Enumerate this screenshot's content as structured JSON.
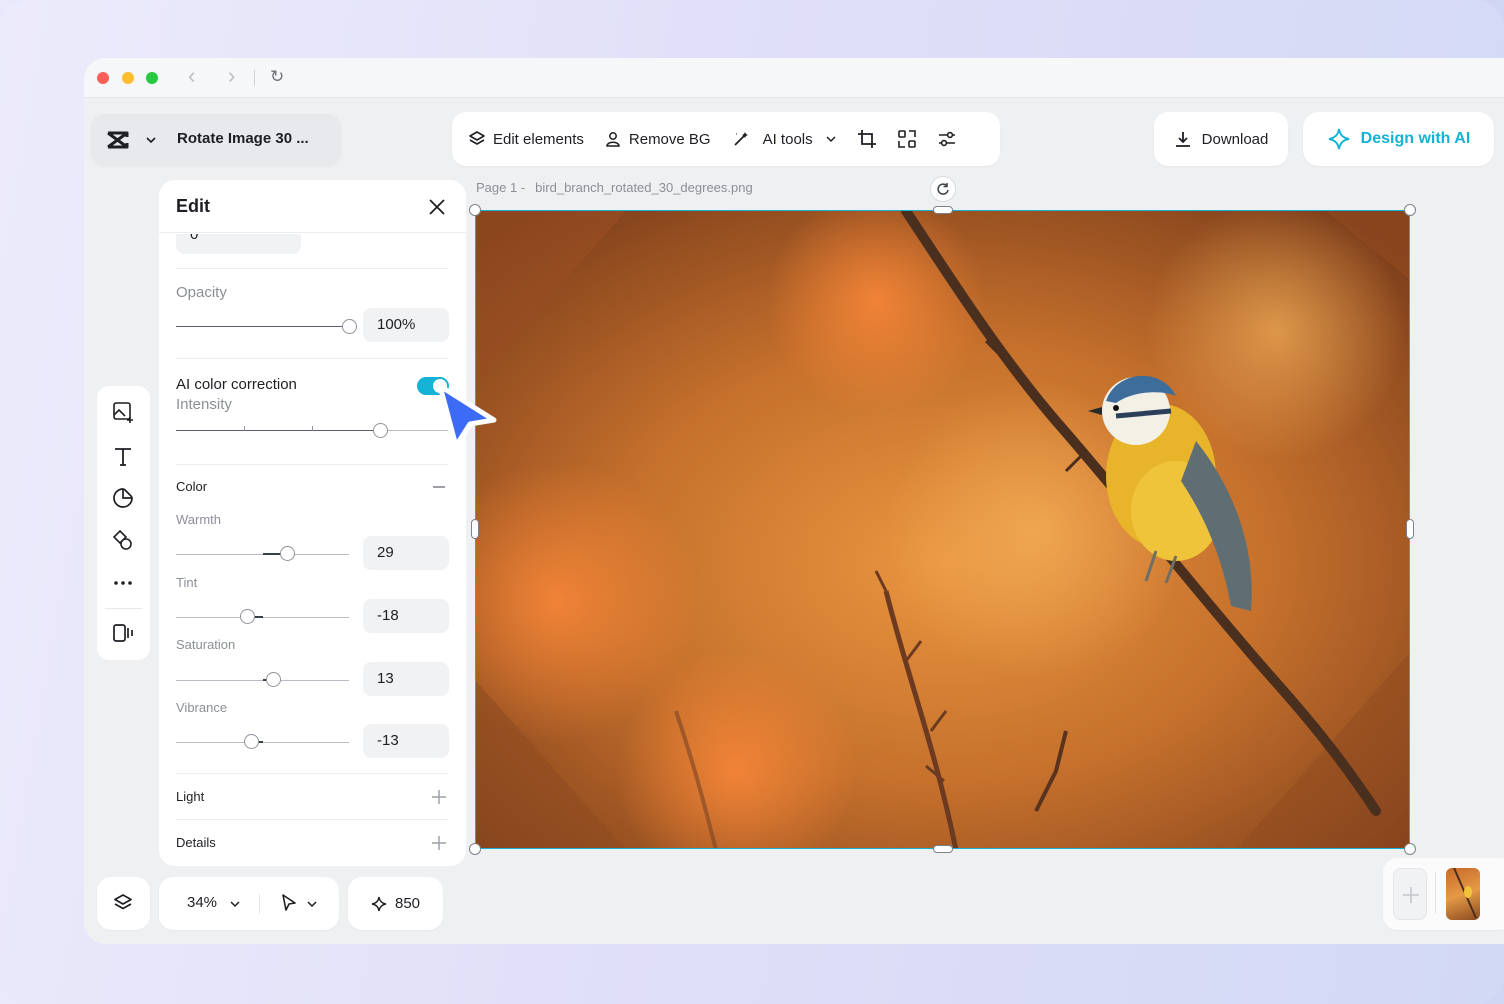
{
  "window": {
    "back_glyph": "‹",
    "forward_glyph": "›",
    "reload_glyph": "↻"
  },
  "project": {
    "title": "Rotate Image 30 ...",
    "logo_icon": "capcut-logo-icon"
  },
  "toolbar": {
    "edit_elements": "Edit elements",
    "remove_bg": "Remove BG",
    "ai_tools": "AI tools"
  },
  "actions": {
    "download": "Download",
    "design_ai": "Design with AI",
    "accent": "#14b3d6"
  },
  "canvas": {
    "page_label": "Page 1 -",
    "file_name": "bird_branch_rotated_30_degrees.png"
  },
  "edit_panel": {
    "title": "Edit",
    "top_value": "0",
    "opacity": {
      "label": "Opacity",
      "value": "100%",
      "level": 1.0
    },
    "ai_color": {
      "label": "AI color correction",
      "intensity_label": "Intensity",
      "enabled": true,
      "intensity_level": 0.77
    },
    "color_section": "Color",
    "warmth": {
      "label": "Warmth",
      "value": "29"
    },
    "tint": {
      "label": "Tint",
      "value": "-18"
    },
    "saturation": {
      "label": "Saturation",
      "value": "13"
    },
    "vibrance": {
      "label": "Vibrance",
      "value": "-13"
    },
    "light_section": "Light",
    "details_section": "Details"
  },
  "bottom": {
    "zoom": "34%",
    "credits": "850"
  }
}
